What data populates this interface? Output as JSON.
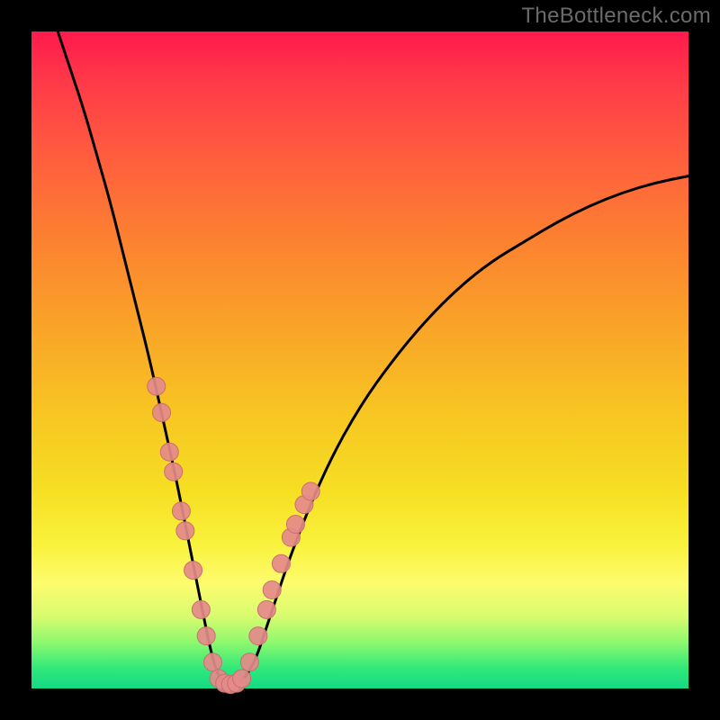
{
  "watermark": "TheBottleneck.com",
  "colors": {
    "frame": "#000000",
    "curve": "#000000",
    "marker_fill": "#e48a8a",
    "marker_stroke": "#c96f6f",
    "gradient_top": "#ff1a4d",
    "gradient_mid": "#f7c522",
    "gradient_bottom": "#14d984"
  },
  "chart_data": {
    "type": "line",
    "title": "",
    "xlabel": "",
    "ylabel": "",
    "xlim": [
      0,
      100
    ],
    "ylim": [
      0,
      100
    ],
    "grid": false,
    "series": [
      {
        "name": "bottleneck-curve",
        "x": [
          4,
          6,
          8,
          10,
          12,
          14,
          16,
          18,
          20,
          22,
          24,
          26,
          27,
          28,
          29,
          30,
          31,
          32,
          34,
          36,
          40,
          45,
          50,
          55,
          60,
          65,
          70,
          75,
          80,
          85,
          90,
          95,
          100
        ],
        "values": [
          100,
          94,
          88,
          81,
          74,
          66,
          58,
          50,
          41,
          32,
          22,
          12,
          7,
          3,
          1,
          0.5,
          0.5,
          1,
          4,
          10,
          22,
          34,
          43,
          50,
          56,
          61,
          65,
          68,
          71,
          73.5,
          75.5,
          77,
          78
        ]
      }
    ],
    "markers": [
      {
        "series": "left-branch",
        "x": 19.0,
        "y": 46
      },
      {
        "series": "left-branch",
        "x": 19.8,
        "y": 42
      },
      {
        "series": "left-branch",
        "x": 21.0,
        "y": 36
      },
      {
        "series": "left-branch",
        "x": 21.6,
        "y": 33
      },
      {
        "series": "left-branch",
        "x": 22.8,
        "y": 27
      },
      {
        "series": "left-branch",
        "x": 23.4,
        "y": 24
      },
      {
        "series": "left-branch",
        "x": 24.6,
        "y": 18
      },
      {
        "series": "left-branch",
        "x": 25.8,
        "y": 12
      },
      {
        "series": "left-branch",
        "x": 26.6,
        "y": 8
      },
      {
        "series": "left-branch",
        "x": 27.6,
        "y": 4
      },
      {
        "series": "valley",
        "x": 28.5,
        "y": 1.5
      },
      {
        "series": "valley",
        "x": 29.4,
        "y": 0.8
      },
      {
        "series": "valley",
        "x": 30.3,
        "y": 0.6
      },
      {
        "series": "valley",
        "x": 31.2,
        "y": 0.8
      },
      {
        "series": "valley",
        "x": 32.0,
        "y": 1.5
      },
      {
        "series": "right-branch",
        "x": 33.2,
        "y": 4
      },
      {
        "series": "right-branch",
        "x": 34.5,
        "y": 8
      },
      {
        "series": "right-branch",
        "x": 35.8,
        "y": 12
      },
      {
        "series": "right-branch",
        "x": 36.6,
        "y": 15
      },
      {
        "series": "right-branch",
        "x": 38.0,
        "y": 19
      },
      {
        "series": "right-branch",
        "x": 39.5,
        "y": 23
      },
      {
        "series": "right-branch",
        "x": 40.2,
        "y": 25
      },
      {
        "series": "right-branch",
        "x": 41.5,
        "y": 28
      },
      {
        "series": "right-branch",
        "x": 42.5,
        "y": 30
      }
    ]
  }
}
